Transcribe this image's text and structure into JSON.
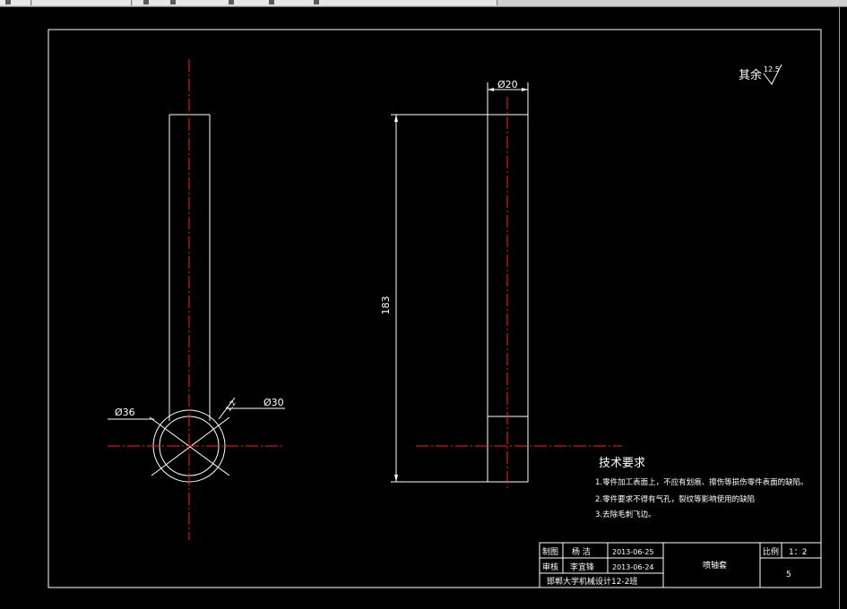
{
  "drawing": {
    "colors": {
      "outline": "#ffffff",
      "centerline": "#ff2020",
      "background": "#000000"
    },
    "dimensions": {
      "dia_outer": "Ø36",
      "dia_inner": "Ø30",
      "chamfer": "1.2",
      "dia_rod": "Ø20",
      "length": "183"
    },
    "roughness": {
      "label": "其余",
      "value": "12.5"
    },
    "tech_requirements": {
      "title": "技术要求",
      "items": [
        "1.零件加工表面上，不应有划痕、擦伤等损伤零件表面的缺陷。",
        "2.零件要求不得有气孔，裂纹等影响使用的缺陷",
        "3.去除毛刺飞边。"
      ]
    },
    "title_block": {
      "drawn_label": "制图",
      "drawn_name": "杨 洁",
      "drawn_date": "2013-06-25",
      "checked_label": "审核",
      "checked_name": "李宜锋",
      "checked_date": "2013-06-24",
      "part_name": "喷轴套",
      "scale_label": "比例",
      "scale_value": "1：2",
      "sheet_no": "5",
      "school": "邯郸大学机械设计12-2班"
    }
  }
}
